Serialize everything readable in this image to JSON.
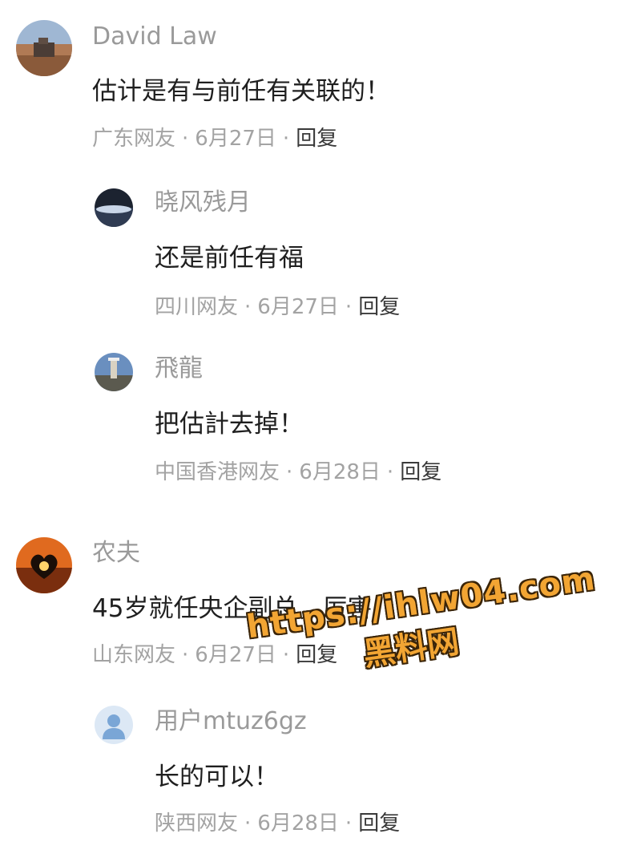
{
  "comments": [
    {
      "avatar_icon": "photo-avatar-ship",
      "name": "David Law",
      "text": "估计是有与前任有关联的！",
      "location": "广东网友",
      "date": "6月27日",
      "reply_label": "回复",
      "replies": [
        {
          "avatar_icon": "photo-avatar-moon",
          "name": "晓风残月",
          "text": "还是前任有福",
          "location": "四川网友",
          "date": "6月27日",
          "reply_label": "回复"
        },
        {
          "avatar_icon": "photo-avatar-landscape",
          "name": "飛龍",
          "text": "把估計去掉！",
          "location": "中国香港网友",
          "date": "6月28日",
          "reply_label": "回复"
        }
      ]
    },
    {
      "avatar_icon": "photo-avatar-heart-sunset",
      "name": "农夫",
      "text": "45岁就任央企副总，厉害",
      "location": "山东网友",
      "date": "6月27日",
      "reply_label": "回复",
      "replies": [
        {
          "avatar_icon": "default-user-avatar-icon",
          "name": "用户mtuz6gz",
          "text": "长的可以！",
          "location": "陕西网友",
          "date": "6月28日",
          "reply_label": "回复"
        }
      ]
    }
  ],
  "separator": "·",
  "watermark": {
    "url": "https://ihlw04.com",
    "site": "黑料网"
  }
}
